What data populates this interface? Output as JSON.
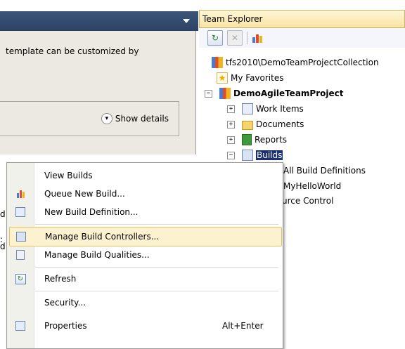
{
  "editor": {
    "description": "template can be customized by",
    "show_details": "Show details",
    "fragments": [
      "d",
      ":",
      "d"
    ]
  },
  "team_explorer": {
    "title": "Team Explorer",
    "tree": {
      "collection": "tfs2010\\DemoTeamProjectCollection",
      "favorites": "My Favorites",
      "project": "DemoAgileTeamProject",
      "work_items": "Work Items",
      "documents": "Documents",
      "reports": "Reports",
      "builds": "Builds",
      "all_build_defs": "All Build Definitions",
      "hello_world": "MyHelloWorld",
      "source_control": "urce Control"
    }
  },
  "context_menu": {
    "items": [
      {
        "label": "View Builds",
        "icon": "none"
      },
      {
        "label": "Queue New Build...",
        "icon": "queue-build-icon"
      },
      {
        "label": "New Build Definition...",
        "icon": "new-build-definition-icon"
      },
      {
        "label": "Manage Build Controllers...",
        "icon": "build-controller-icon",
        "highlighted": true
      },
      {
        "label": "Manage Build Qualities...",
        "icon": "build-quality-icon"
      },
      {
        "label": "Refresh",
        "icon": "refresh-icon"
      },
      {
        "label": "Security...",
        "icon": "none"
      },
      {
        "label": "Properties",
        "icon": "properties-icon",
        "shortcut": "Alt+Enter"
      }
    ]
  },
  "colors": {
    "highlight": "#fdf2cf",
    "selection": "#1c2f6e",
    "header": "#f8e3a3"
  }
}
